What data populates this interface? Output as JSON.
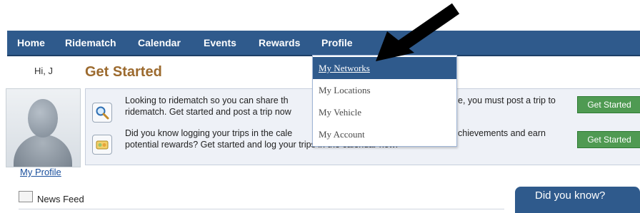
{
  "nav": {
    "items": [
      {
        "label": "Home"
      },
      {
        "label": "Ridematch"
      },
      {
        "label": "Calendar"
      },
      {
        "label": "Events"
      },
      {
        "label": "Rewards"
      },
      {
        "label": "Profile"
      }
    ]
  },
  "profile_menu": {
    "items": [
      {
        "label": "My Networks",
        "active": true
      },
      {
        "label": "My Locations"
      },
      {
        "label": "My Vehicle"
      },
      {
        "label": "My Account"
      }
    ]
  },
  "user": {
    "greeting": "Hi, J",
    "profile_link": "My Profile"
  },
  "main": {
    "title": "Get Started",
    "rows": [
      {
        "icon": "magnifier-icon",
        "text_line1": "Looking to ridematch so you can share th",
        "text_line1_end": "e, you must post a trip to",
        "text_line2": "ridematch. Get started and post a trip now",
        "button": "Get Started"
      },
      {
        "icon": "rewards-icon",
        "text_line1": "Did you know logging your trips in the cale",
        "text_line1_end": "chievements and earn",
        "text_line2": "potential rewards? Get started and log your trips in the calendar now!",
        "button": "Get Started"
      }
    ]
  },
  "news_feed": {
    "label": "News Feed"
  },
  "did_you_know": {
    "label": "Did you know?"
  },
  "colors": {
    "nav": "#2f5a8c",
    "title": "#9c6a2e",
    "button": "#4f9a52"
  }
}
